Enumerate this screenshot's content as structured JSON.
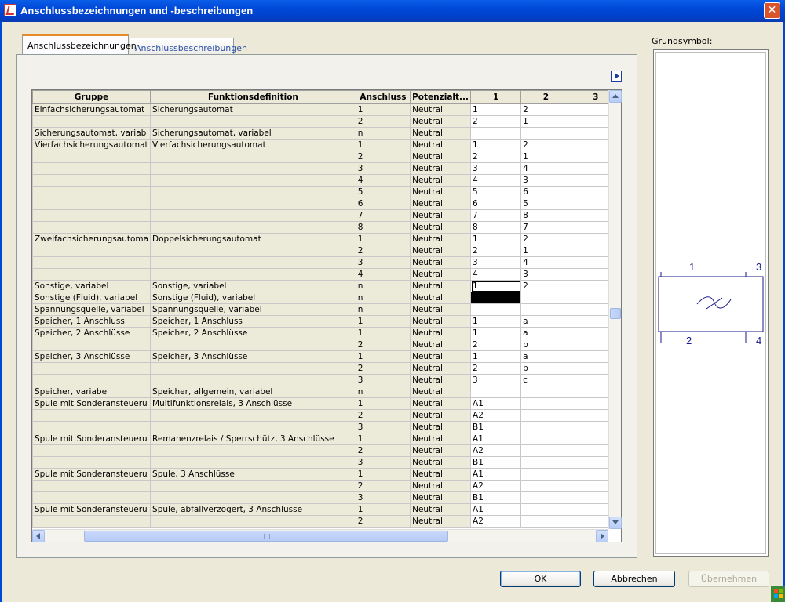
{
  "window": {
    "title": "Anschlussbezeichnungen und -beschreibungen",
    "close_glyph": "✕"
  },
  "tabs": [
    {
      "label": "Anschlussbezeichnungen",
      "active": true
    },
    {
      "label": "Anschlussbeschreibungen",
      "active": false
    }
  ],
  "table": {
    "columns": [
      "Gruppe",
      "Funktionsdefinition",
      "Anschluss",
      "Potenzialt...",
      "1",
      "2",
      "3"
    ],
    "rows": [
      [
        "Einfachsicherungsautomat",
        "Sicherungsautomat",
        "1",
        "Neutral",
        "1",
        "2",
        ""
      ],
      [
        "",
        "",
        "2",
        "Neutral",
        "2",
        "1",
        ""
      ],
      [
        "Sicherungsautomat, variab",
        "Sicherungsautomat, variabel",
        "n",
        "Neutral",
        "",
        "",
        ""
      ],
      [
        "Vierfachsicherungsautomat",
        "Vierfachsicherungsautomat",
        "1",
        "Neutral",
        "1",
        "2",
        ""
      ],
      [
        "",
        "",
        "2",
        "Neutral",
        "2",
        "1",
        ""
      ],
      [
        "",
        "",
        "3",
        "Neutral",
        "3",
        "4",
        ""
      ],
      [
        "",
        "",
        "4",
        "Neutral",
        "4",
        "3",
        ""
      ],
      [
        "",
        "",
        "5",
        "Neutral",
        "5",
        "6",
        ""
      ],
      [
        "",
        "",
        "6",
        "Neutral",
        "6",
        "5",
        ""
      ],
      [
        "",
        "",
        "7",
        "Neutral",
        "7",
        "8",
        ""
      ],
      [
        "",
        "",
        "8",
        "Neutral",
        "8",
        "7",
        ""
      ],
      [
        "Zweifachsicherungsautoma",
        "Doppelsicherungsautomat",
        "1",
        "Neutral",
        "1",
        "2",
        ""
      ],
      [
        "",
        "",
        "2",
        "Neutral",
        "2",
        "1",
        ""
      ],
      [
        "",
        "",
        "3",
        "Neutral",
        "3",
        "4",
        ""
      ],
      [
        "",
        "",
        "4",
        "Neutral",
        "4",
        "3",
        ""
      ],
      [
        "Sonstige, variabel",
        "Sonstige, variabel",
        "n",
        "Neutral",
        "1",
        "2",
        ""
      ],
      [
        "Sonstige (Fluid), variabel",
        "Sonstige (Fluid), variabel",
        "n",
        "Neutral",
        "",
        "",
        ""
      ],
      [
        "Spannungsquelle, variabel",
        "Spannungsquelle, variabel",
        "n",
        "Neutral",
        "",
        "",
        ""
      ],
      [
        "Speicher, 1 Anschluss",
        "Speicher, 1 Anschluss",
        "1",
        "Neutral",
        "1",
        "a",
        ""
      ],
      [
        "Speicher, 2 Anschlüsse",
        "Speicher, 2 Anschlüsse",
        "1",
        "Neutral",
        "1",
        "a",
        ""
      ],
      [
        "",
        "",
        "2",
        "Neutral",
        "2",
        "b",
        ""
      ],
      [
        "Speicher, 3 Anschlüsse",
        "Speicher, 3 Anschlüsse",
        "1",
        "Neutral",
        "1",
        "a",
        ""
      ],
      [
        "",
        "",
        "2",
        "Neutral",
        "2",
        "b",
        ""
      ],
      [
        "",
        "",
        "3",
        "Neutral",
        "3",
        "c",
        ""
      ],
      [
        "Speicher, variabel",
        "Speicher, allgemein, variabel",
        "n",
        "Neutral",
        "",
        "",
        ""
      ],
      [
        "Spule mit Sonderansteueru",
        "Multifunktionsrelais, 3 Anschlüsse",
        "1",
        "Neutral",
        "A1",
        "",
        ""
      ],
      [
        "",
        "",
        "2",
        "Neutral",
        "A2",
        "",
        ""
      ],
      [
        "",
        "",
        "3",
        "Neutral",
        "B1",
        "",
        ""
      ],
      [
        "Spule mit Sonderansteueru",
        "Remanenzrelais / Sperrschütz, 3 Anschlüsse",
        "1",
        "Neutral",
        "A1",
        "",
        ""
      ],
      [
        "",
        "",
        "2",
        "Neutral",
        "A2",
        "",
        ""
      ],
      [
        "",
        "",
        "3",
        "Neutral",
        "B1",
        "",
        ""
      ],
      [
        "Spule mit Sonderansteueru",
        "Spule, 3 Anschlüsse",
        "1",
        "Neutral",
        "A1",
        "",
        ""
      ],
      [
        "",
        "",
        "2",
        "Neutral",
        "A2",
        "",
        ""
      ],
      [
        "",
        "",
        "3",
        "Neutral",
        "B1",
        "",
        ""
      ],
      [
        "Spule mit Sonderansteueru",
        "Spule, abfallverzögert, 3 Anschlüsse",
        "1",
        "Neutral",
        "A1",
        "",
        ""
      ],
      [
        "",
        "",
        "2",
        "Neutral",
        "A2",
        "",
        ""
      ]
    ]
  },
  "preview": {
    "label": "Grundsymbol:",
    "pin_labels": {
      "top_left": "1",
      "top_right": "3",
      "bottom_left": "2",
      "bottom_right": "4"
    }
  },
  "buttons": {
    "ok": "OK",
    "cancel": "Abbrechen",
    "apply": "Übernehmen"
  }
}
